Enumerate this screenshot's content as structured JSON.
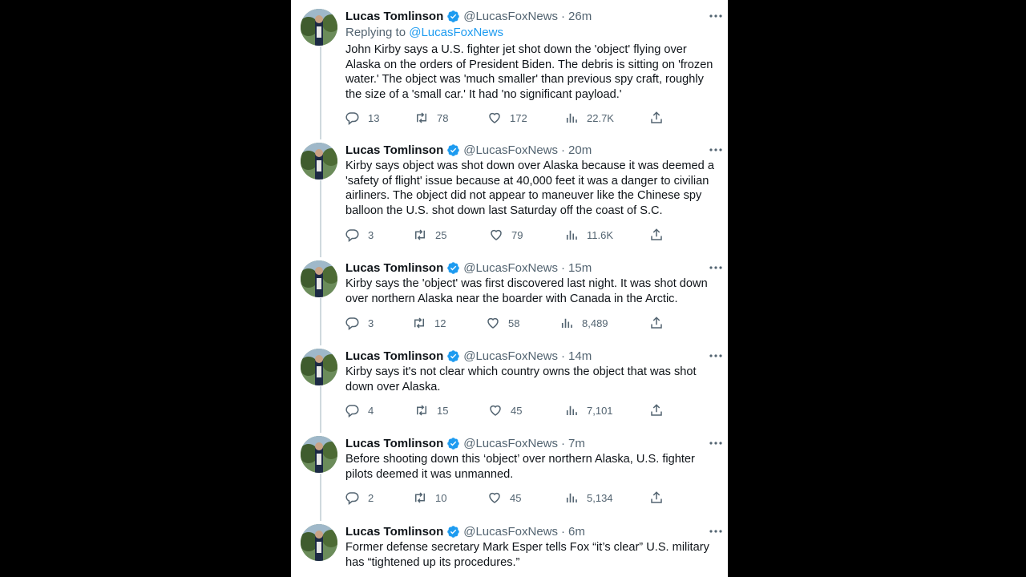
{
  "author": {
    "name": "Lucas Tomlinson",
    "handle": "@LucasFoxNews"
  },
  "colors": {
    "accent": "#1d9bf0",
    "text": "#0f1419",
    "secondary": "#536471",
    "thread_line": "#cfd9de"
  },
  "tweets": [
    {
      "time": "26m",
      "replying_prefix": "Replying to",
      "replying_to": "@LucasFoxNews",
      "text": "John Kirby says a U.S. fighter jet shot down the 'object' flying over Alaska on the orders of President Biden. The debris is sitting on 'frozen water.' The object was 'much smaller' than previous spy craft, roughly the size of a 'small car.' It had 'no significant payload.'",
      "replies": "13",
      "retweets": "78",
      "likes": "172",
      "views": "22.7K"
    },
    {
      "time": "20m",
      "text": "Kirby says object was shot down over Alaska because it was deemed a 'safety of flight' issue because at 40,000 feet it was a danger to civilian airliners. The object did not appear to maneuver like the Chinese spy balloon the U.S. shot down last Saturday off the coast of S.C.",
      "replies": "3",
      "retweets": "25",
      "likes": "79",
      "views": "11.6K"
    },
    {
      "time": "15m",
      "text": "Kirby says the 'object' was first discovered last night. It was shot down over northern Alaska near the boarder with Canada in the Arctic.",
      "replies": "3",
      "retweets": "12",
      "likes": "58",
      "views": "8,489"
    },
    {
      "time": "14m",
      "text": "Kirby says it's not clear which country owns the object that was shot down over Alaska.",
      "replies": "4",
      "retweets": "15",
      "likes": "45",
      "views": "7,101"
    },
    {
      "time": "7m",
      "text": "Before shooting down this ‘object’ over northern Alaska, U.S. fighter pilots deemed it was unmanned.",
      "replies": "2",
      "retweets": "10",
      "likes": "45",
      "views": "5,134"
    },
    {
      "time": "6m",
      "text": "Former defense secretary Mark Esper tells Fox “it’s clear” U.S. military has “tightened up its procedures.”"
    }
  ],
  "icons": {
    "avatar": "avatar-photo",
    "verified": "verified-badge-icon",
    "more": "more-options-icon",
    "reply": "reply-icon",
    "retweet": "retweet-icon",
    "like": "heart-icon",
    "views": "analytics-icon",
    "share": "share-icon"
  }
}
